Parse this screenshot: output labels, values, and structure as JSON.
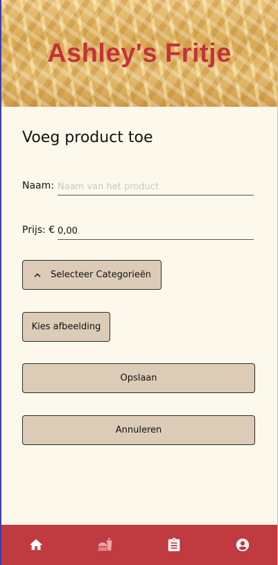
{
  "header": {
    "title": "Ashley's Fritje"
  },
  "form": {
    "page_title": "Voeg product toe",
    "name": {
      "label": "Naam:",
      "value": "",
      "placeholder": "Naam van het product"
    },
    "price": {
      "label": "Prijs: €",
      "value": "0,00"
    },
    "categories_button": "Selecteer Categorieën",
    "image_button": "Kies afbeelding",
    "save_button": "Opslaan",
    "cancel_button": "Annuleren"
  },
  "nav": {
    "items": [
      {
        "icon": "home-icon",
        "active": true
      },
      {
        "icon": "food-icon",
        "active": false
      },
      {
        "icon": "clipboard-icon",
        "active": true
      },
      {
        "icon": "account-icon",
        "active": true
      }
    ]
  },
  "colors": {
    "accent": "#bf3b40",
    "title": "#c4323a",
    "button_bg": "#dccbb6",
    "background": "#fcf8ec"
  }
}
